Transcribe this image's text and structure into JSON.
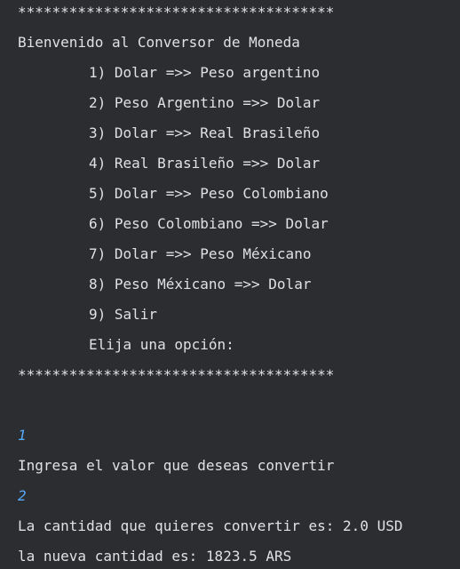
{
  "console": {
    "banner_top": "*************************************",
    "welcome": "Bienvenido al Conversor de Moneda",
    "options": [
      "1) Dolar =>> Peso argentino",
      "2) Peso Argentino =>> Dolar",
      "3) Dolar =>> Real Brasileño",
      "4) Real Brasileño =>> Dolar",
      "5) Dolar =>> Peso Colombiano",
      "6) Peso Colombiano =>> Dolar",
      "7) Dolar =>> Peso Méxicano",
      "8) Peso Méxicano =>> Dolar",
      "9) Salir"
    ],
    "prompt_option": "Elija una opción:",
    "banner_bottom": "*************************************",
    "user_input_option": "1",
    "prompt_value": "Ingresa el valor que deseas convertir",
    "user_input_value": "2",
    "result_amount": "La cantidad que quieres convertir es: 2.0 USD",
    "result_new": "la nueva cantidad es: 1823.5 ARS"
  },
  "colors": {
    "background": "#2b2d30",
    "text": "#dfe1e5",
    "user_input": "#57a8f5"
  }
}
